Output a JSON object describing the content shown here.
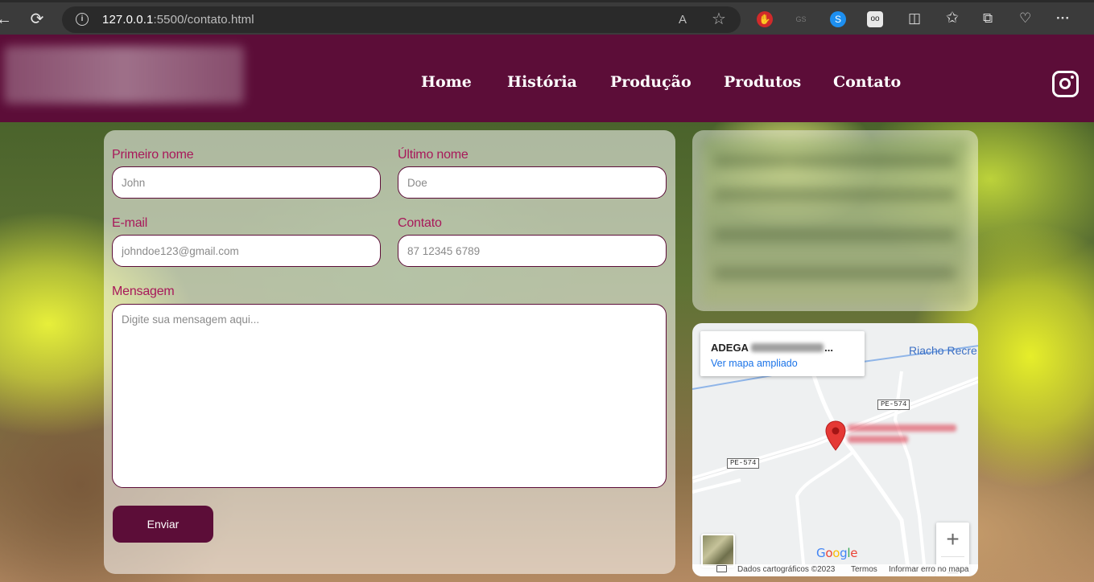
{
  "browser": {
    "url_host": "127.0.0.1",
    "url_path": ":5500/contato.html",
    "back_glyph": "←",
    "reload_glyph": "⟳",
    "info_glyph": "i",
    "read_aloud_glyph": "A",
    "favorite_glyph": "☆",
    "split_glyph": "◫",
    "favorites_glyph": "✩",
    "collections_glyph": "⧉",
    "performance_glyph": "♡",
    "menu_glyph": "···"
  },
  "nav": {
    "items": [
      "Home",
      "História",
      "Produção",
      "Produtos",
      "Contato"
    ]
  },
  "form": {
    "first_name_label": "Primeiro nome",
    "first_name_placeholder": "John",
    "last_name_label": "Último nome",
    "last_name_placeholder": "Doe",
    "email_label": "E-mail",
    "email_placeholder": "johndoe123@gmail.com",
    "contact_label": "Contato",
    "contact_placeholder": "87 12345 6789",
    "message_label": "Mensagem",
    "message_placeholder": "Digite sua mensagem aqui...",
    "submit_label": "Enviar"
  },
  "map": {
    "card_title_prefix": "ADEGA",
    "card_title_ellipsis": "...",
    "card_link": "Ver mapa ampliado",
    "river_label": "Riacho Recre",
    "road_label_1": "PE-574",
    "road_label_2": "PE-574",
    "zoom_in": "+",
    "zoom_out": "−",
    "google": [
      "G",
      "o",
      "o",
      "g",
      "l",
      "e"
    ],
    "footer_data": "Dados cartográficos ©2023",
    "footer_terms": "Termos",
    "footer_report": "Informar erro no mapa"
  },
  "colors": {
    "header_bg": "#5c0d38",
    "label_color": "#a8185a",
    "button_bg": "#5c0d38"
  }
}
